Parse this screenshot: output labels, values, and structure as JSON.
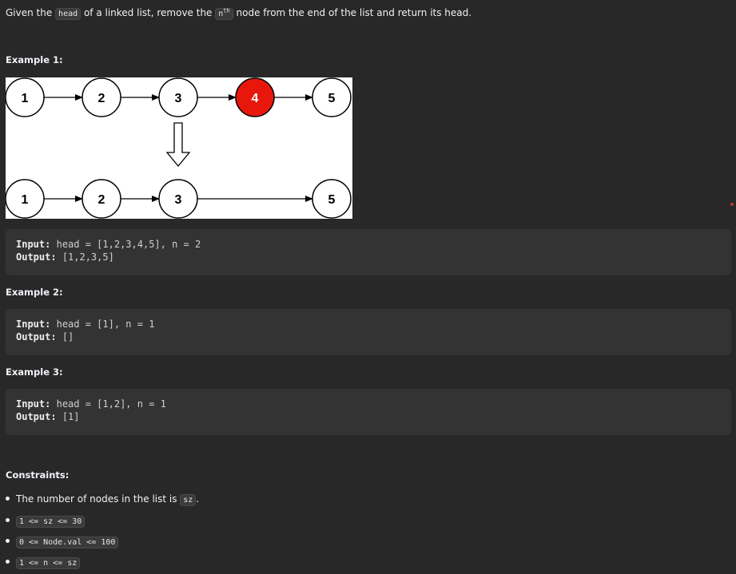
{
  "description": {
    "prefix": "Given the ",
    "code_head": "head",
    "middle": " of a linked list, remove the ",
    "code_n": "n",
    "sup_th": "th",
    "suffix": " node from the end of the list and return its head."
  },
  "examples": [
    {
      "heading": "Example 1:",
      "figure": {
        "top_nodes": [
          "1",
          "2",
          "3",
          "4",
          "5"
        ],
        "removed_index": 3,
        "bottom_nodes": [
          "1",
          "2",
          "3",
          "5"
        ],
        "arrow_symbol": "⇩",
        "colors": {
          "removed_fill": "#e8170c",
          "node_stroke": "#000000"
        }
      },
      "input_label": "Input:",
      "input_value": "head = [1,2,3,4,5], n = 2",
      "output_label": "Output:",
      "output_value": "[1,2,3,5]"
    },
    {
      "heading": "Example 2:",
      "input_label": "Input:",
      "input_value": "head = [1], n = 1",
      "output_label": "Output:",
      "output_value": "[]"
    },
    {
      "heading": "Example 3:",
      "input_label": "Input:",
      "input_value": "head = [1,2], n = 1",
      "output_label": "Output:",
      "output_value": "[1]"
    }
  ],
  "constraints": {
    "heading": "Constraints:",
    "item1_prefix": "The number of nodes in the list is ",
    "item1_code": "sz",
    "item1_suffix": ".",
    "item2": "1 <= sz <= 30",
    "item3": "0 <= Node.val <= 100",
    "item4": "1 <= n <= sz"
  }
}
